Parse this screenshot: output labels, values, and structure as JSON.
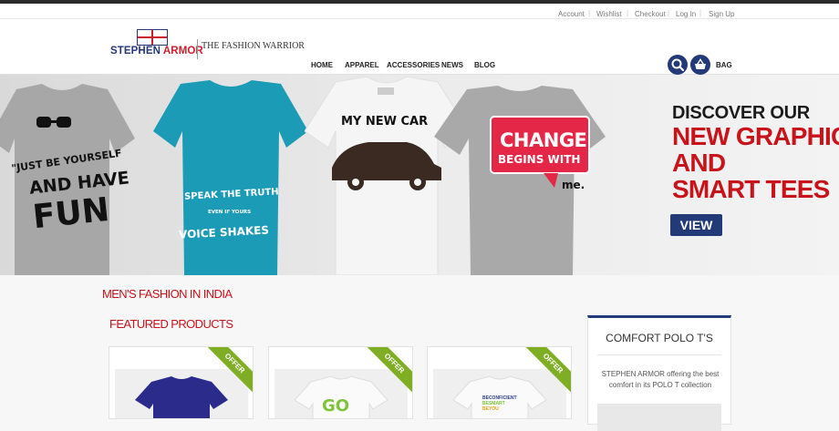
{
  "util_links": [
    "Account",
    "Wishlist",
    "Checkout",
    "Log In",
    "Sign Up"
  ],
  "brand": {
    "name_main": "STEPHEN ",
    "name_accent": "ARMOR",
    "tagline": "THE FASHION WARRIOR"
  },
  "nav": [
    "HOME",
    "APPAREL",
    "ACCESSORIES",
    "NEWS",
    "BLOG"
  ],
  "header_actions": {
    "bag_label": "BAG",
    "search_icon": "search-icon",
    "basket_icon": "basket-icon"
  },
  "banner": {
    "shirt1": {
      "l1": "\"JUST BE YOURSELF",
      "l2": "AND HAVE",
      "l3": "FUN",
      "color": "#a9a9a9"
    },
    "shirt2": {
      "l1": "SPEAK THE TRUTH",
      "l2": "EVEN IF YOURS",
      "l3": "VOICE SHAKES",
      "color": "#1b9bb6"
    },
    "shirt3": {
      "l1": "MY NEW CAR",
      "color": "#f4f4f4"
    },
    "shirt4": {
      "l1": "CHANGE",
      "l2": "BEGINS WITH",
      "l3": "me.",
      "color": "#a9a9a9"
    },
    "headline_1": "DISCOVER OUR",
    "headline_2": "NEW GRAPHIC",
    "headline_3": "AND",
    "headline_4": "SMART TEES",
    "cta": "VIEW"
  },
  "sections": {
    "mens_fashion": "MEN'S FASHION IN INDIA",
    "featured": "FEATURED PRODUCTS"
  },
  "products": [
    {
      "badge": "OFFER"
    },
    {
      "badge": "OFFER",
      "print": "GO"
    },
    {
      "badge": "OFFER",
      "print_lines": [
        "BECONFICIENT",
        "BESMART",
        "BEYOU"
      ]
    }
  ],
  "sidebar": {
    "title": "COMFORT POLO T'S",
    "text": "STEPHEN ARMOR offering the best comfort in its POLO T collection"
  },
  "colors": {
    "brand_navy": "#233a78",
    "brand_red": "#c8131b",
    "offer_green": "#7fae24"
  }
}
